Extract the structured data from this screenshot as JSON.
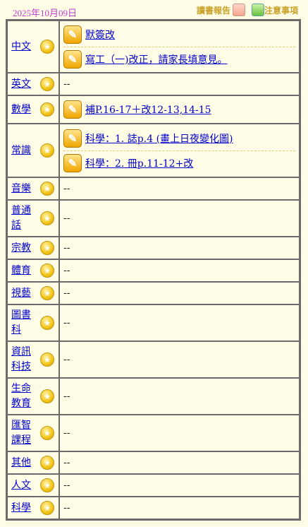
{
  "header": {
    "date": "2025年10月09日",
    "read_report_label": "讀書報告",
    "notice_label": "注意事項"
  },
  "icons": {
    "subject": "star-icon",
    "homework": "pencil-note-icon",
    "read_report": "book-icon",
    "notice": "check-note-icon"
  },
  "colors": {
    "date": "#c23bd0",
    "link": "#0000cc",
    "header_links": "#c9a22a"
  },
  "subjects": [
    {
      "name": "中文",
      "homework": [
        "默簽改",
        "寫工（一)改正，請家長填意見。"
      ]
    },
    {
      "name": "英文",
      "homework": [],
      "empty": "--"
    },
    {
      "name": "數學",
      "homework": [
        "補P.16-17＋改12-13,14-15"
      ]
    },
    {
      "name": "常識",
      "homework": [
        "科學：1. 誌p.4 (畫上日夜變化圖)",
        "科學：2. 冊p.11-12+改"
      ]
    },
    {
      "name": "音樂",
      "homework": [],
      "empty": "--"
    },
    {
      "name": "普通話",
      "homework": [],
      "empty": "--"
    },
    {
      "name": "宗教",
      "homework": [],
      "empty": "--"
    },
    {
      "name": "體育",
      "homework": [],
      "empty": "--"
    },
    {
      "name": "視藝",
      "homework": [],
      "empty": "--"
    },
    {
      "name": "圖書科",
      "homework": [],
      "empty": "--"
    },
    {
      "name": "資訊科技",
      "homework": [],
      "empty": "--"
    },
    {
      "name": "生命教育",
      "homework": [],
      "empty": "--"
    },
    {
      "name": "匯智課程",
      "homework": [],
      "empty": "--"
    },
    {
      "name": "其他",
      "homework": [],
      "empty": "--"
    },
    {
      "name": "人文",
      "homework": [],
      "empty": "--"
    },
    {
      "name": "科學",
      "homework": [],
      "empty": "--"
    }
  ]
}
